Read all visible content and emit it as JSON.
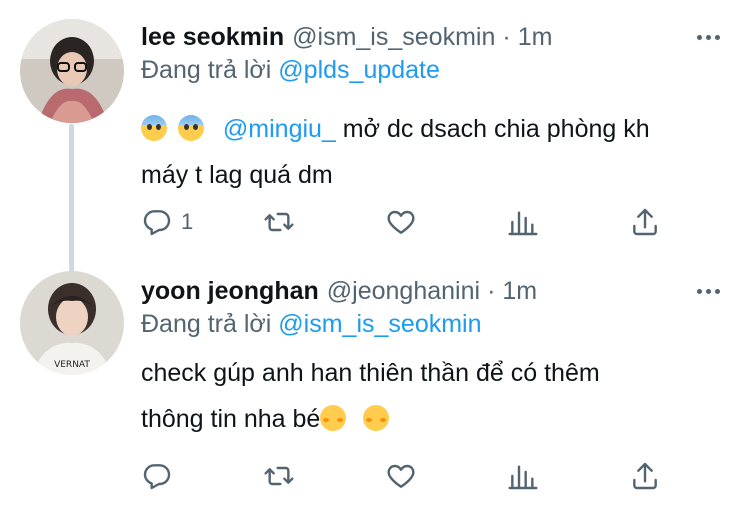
{
  "tweets": [
    {
      "display_name": "lee seokmin",
      "handle": "@ism_is_seokmin",
      "separator": "·",
      "time": "1m",
      "reply_prefix": "Đang trả lời",
      "reply_to": "@plds_update",
      "body_mention": "@mingiu_",
      "body_line1": "mở dc dsach chia phòng kh",
      "body_line2": "máy t lag quá dm",
      "emojis": [
        "fearful-face",
        "fearful-face"
      ],
      "reply_count": "1"
    },
    {
      "display_name": "yoon jeonghan",
      "handle": "@jeonghanini",
      "separator": "·",
      "time": "1m",
      "reply_prefix": "Đang trả lời",
      "reply_to": "@ism_is_seokmin",
      "body_line1": "check gúp anh han thiên thần để có thêm",
      "body_line2": "thông tin nha bé",
      "emojis": [
        "smiling-blush-face",
        "smiling-blush-face"
      ],
      "reply_count": ""
    }
  ],
  "colors": {
    "accent": "#1d9bf0",
    "text": "#0f1419",
    "muted": "#536471",
    "thread_line": "#cfd9de"
  },
  "icons": [
    "reply-icon",
    "retweet-icon",
    "like-icon",
    "analytics-icon",
    "share-icon",
    "more-icon"
  ]
}
